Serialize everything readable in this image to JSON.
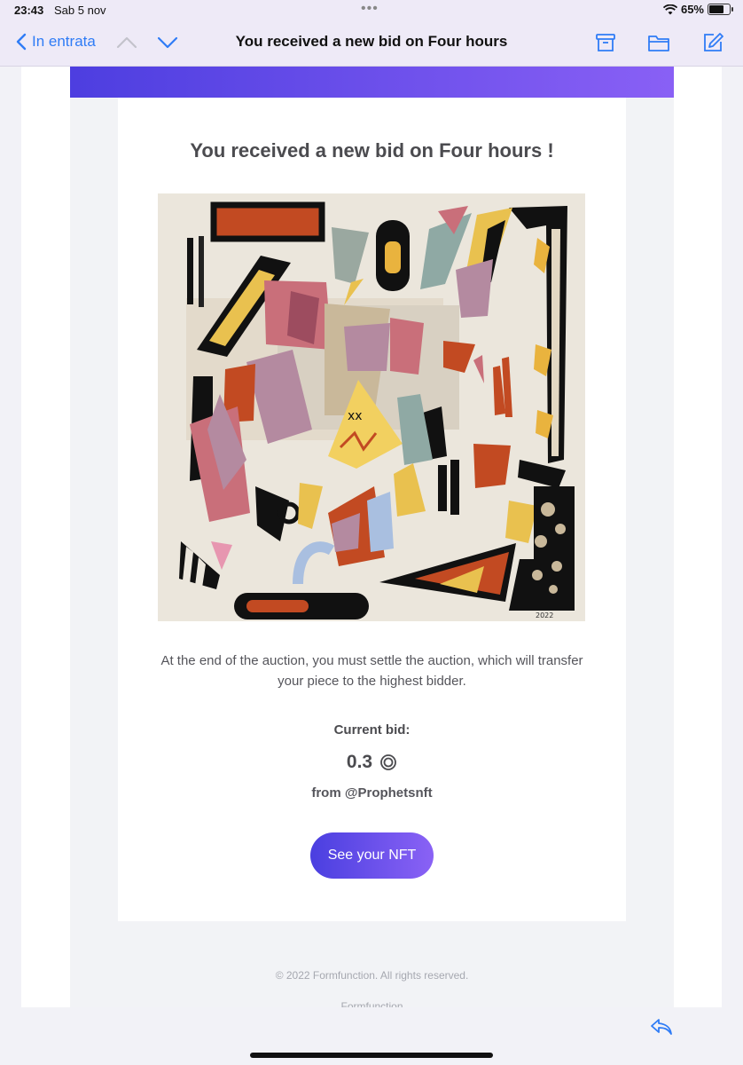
{
  "status_bar": {
    "time": "23:43",
    "date": "Sab 5 nov",
    "battery": "65%",
    "battery_level": 0.65
  },
  "nav": {
    "back_label": "In entrata",
    "title": "You received a new bid on Four hours",
    "icons": [
      "chevron-left-icon",
      "chevron-up-icon",
      "chevron-down-icon",
      "archive-icon",
      "folder-icon",
      "compose-icon"
    ]
  },
  "email": {
    "heading": "You received a new bid on Four hours !",
    "description": "At the end of the auction, you must settle the auction, which will transfer your piece to the highest bidder.",
    "bid_label": "Current bid:",
    "bid_amount": "0.3",
    "currency_icon": "sol-currency-icon",
    "bidder": "from @Prophetsnft",
    "cta_label": "See your NFT",
    "copyright": "© 2022 Formfunction. All rights reserved.",
    "footer_brand": "Formfunction",
    "artwork_signature": "2022",
    "colors": {
      "banner_start": "#4d3ee0",
      "banner_end": "#8960f5",
      "link_blue": "#2f7cf6"
    }
  },
  "toolbar": {
    "icons": [
      "reply-icon"
    ]
  }
}
